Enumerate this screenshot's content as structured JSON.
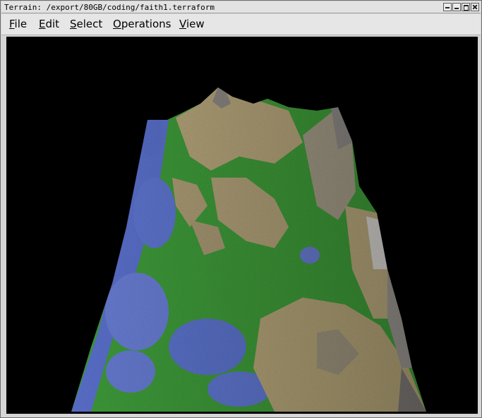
{
  "window": {
    "title": "Terrain: /export/80GB/coding/faith1.terraform"
  },
  "menu": {
    "items": [
      {
        "mnemonic": "F",
        "rest": "ile"
      },
      {
        "mnemonic": "E",
        "rest": "dit"
      },
      {
        "mnemonic": "S",
        "rest": "elect"
      },
      {
        "mnemonic": "O",
        "rest": "perations"
      },
      {
        "mnemonic": "V",
        "rest": "iew"
      }
    ]
  },
  "viewport": {
    "background": "#000000",
    "colors": {
      "water": "#5a74d0",
      "grass": "#3fa03a",
      "sand": "#b6a67a",
      "rock": "#8a8680"
    }
  }
}
